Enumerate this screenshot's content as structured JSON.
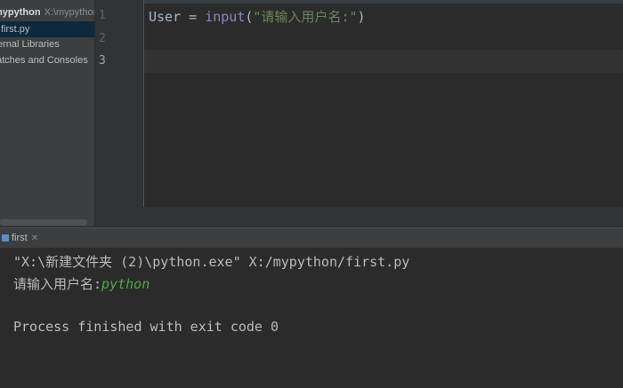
{
  "project": {
    "root_name": "mypython",
    "root_path": "X:\\mypython",
    "file": "first.py",
    "external_libraries": "ernal Libraries",
    "scratches": "atches and Consoles"
  },
  "editor": {
    "line_numbers": [
      "1",
      "2",
      "3"
    ],
    "code": {
      "var": "User",
      "op": " = ",
      "func": "input",
      "paren_open": "(",
      "string": "\"请输入用户名:\"",
      "paren_close": ")"
    }
  },
  "run": {
    "tab_label": "first",
    "tab_icon": "run-config-icon",
    "command": "\"X:\\新建文件夹 (2)\\python.exe\" X:/mypython/first.py",
    "prompt": "请输入用户名:",
    "user_input": "python",
    "exit_message": "Process finished with exit code 0"
  }
}
